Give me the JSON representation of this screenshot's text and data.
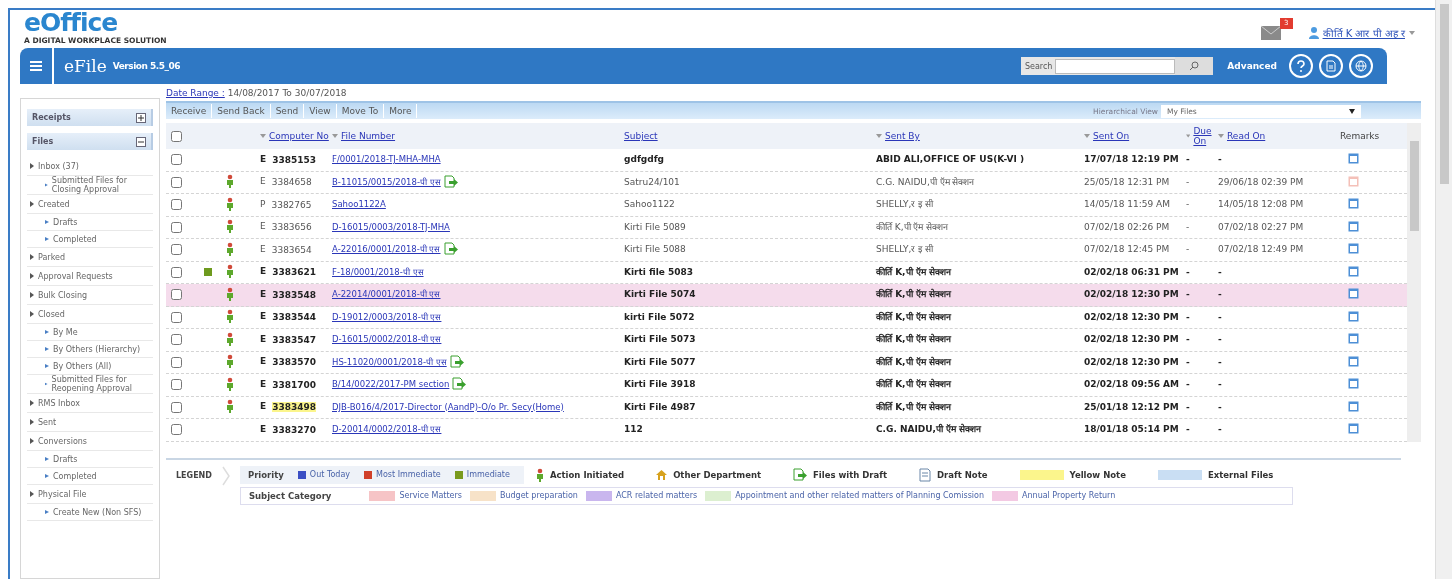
{
  "header": {
    "logo": "eOffice",
    "tagline": "A DIGITAL WORKPLACE SOLUTION",
    "notification_count": "3",
    "user": "कीर्ति K  आर पी अह र"
  },
  "app_bar": {
    "app": "eFile",
    "version": "Version 5.5_06",
    "search_label": "Search",
    "advanced": "Advanced"
  },
  "sidebar": {
    "sections": [
      {
        "label": "Receipts",
        "expanded": false
      },
      {
        "label": "Files",
        "expanded": true,
        "items": [
          {
            "label": "Inbox (37)",
            "children": [
              {
                "label": "Submitted Files for Closing Approval"
              }
            ]
          },
          {
            "label": "Created",
            "children": [
              {
                "label": "Drafts"
              },
              {
                "label": "Completed"
              }
            ]
          },
          {
            "label": "Parked"
          },
          {
            "label": "Approval Requests"
          },
          {
            "label": "Bulk Closing"
          },
          {
            "label": "Closed",
            "children": [
              {
                "label": "By Me"
              },
              {
                "label": "By Others (Hierarchy)"
              },
              {
                "label": "By Others (All)"
              },
              {
                "label": "Submitted Files for Reopening Approval"
              }
            ]
          },
          {
            "label": "RMS Inbox"
          },
          {
            "label": "Sent"
          },
          {
            "label": "Conversions",
            "children": [
              {
                "label": "Drafts"
              },
              {
                "label": "Completed"
              }
            ]
          },
          {
            "label": "Physical File",
            "children": [
              {
                "label": "Create New (Non SFS)"
              }
            ]
          }
        ]
      }
    ]
  },
  "date_range": {
    "label": "Date Range :",
    "value": " 14/08/2017 To 30/07/2018"
  },
  "toolbar": {
    "actions": [
      "Receive",
      "Send Back",
      "Send",
      "View",
      "Move To",
      "More"
    ],
    "view_label": "Hierarchical View",
    "view_value": "My Files"
  },
  "table": {
    "all_selected": false,
    "columns": [
      {
        "label": "Computer No",
        "menu": true
      },
      {
        "label": "File Number",
        "menu": true
      },
      {
        "label": "Subject",
        "menu": false
      },
      {
        "label": "Sent By",
        "menu": true
      },
      {
        "label": "Sent On",
        "menu": true
      },
      {
        "label": "Due On",
        "menu": true
      },
      {
        "label": "Read On",
        "menu": true
      },
      {
        "label": "Remarks",
        "menu": false
      }
    ],
    "rows": [
      {
        "type": "E",
        "number": "3385153",
        "priority_immediate": false,
        "file_number": "F/0001/2018-TJ-MHA-MHA",
        "subject": "gdfgdfg",
        "sent_by": "ABID ALI,OFFICE OF US(K-VI )",
        "sent_on": "17/07/18 12:19 PM",
        "due_on": "-",
        "read_on": "-",
        "unread": true,
        "action_initiated": false,
        "with_draft": false,
        "highlighted": false,
        "yellow_note": false,
        "remark_alert": false
      },
      {
        "type": "E",
        "number": "3384658",
        "priority_immediate": false,
        "file_number": "B-11015/0015/2018-पी एस",
        "subject": "Satru24/101",
        "sent_by": "C.G. NAIDU,पी ऍम सेक्शन",
        "sent_on": "25/05/18 12:31 PM",
        "due_on": "-",
        "read_on": "29/06/18 02:39 PM",
        "unread": false,
        "action_initiated": true,
        "with_draft": true,
        "highlighted": false,
        "yellow_note": false,
        "remark_alert": true
      },
      {
        "type": "P",
        "number": "3382765",
        "priority_immediate": false,
        "file_number": "Sahoo1122A",
        "subject": "Sahoo1122",
        "sent_by": "SHELLY,र इ सी",
        "sent_on": "14/05/18 11:59 AM",
        "due_on": "-",
        "read_on": "14/05/18 12:08 PM",
        "unread": false,
        "action_initiated": true,
        "with_draft": false,
        "highlighted": false,
        "yellow_note": false,
        "remark_alert": false
      },
      {
        "type": "E",
        "number": "3383656",
        "priority_immediate": false,
        "file_number": "D-16015/0003/2018-TJ-MHA",
        "subject": "Kirti File 5089",
        "sent_by": "कीर्ति K,पी ऍम सेक्शन",
        "sent_on": "07/02/18 02:26 PM",
        "due_on": "-",
        "read_on": "07/02/18 02:27 PM",
        "unread": false,
        "action_initiated": true,
        "with_draft": false,
        "highlighted": false,
        "yellow_note": false,
        "remark_alert": false
      },
      {
        "type": "E",
        "number": "3383654",
        "priority_immediate": false,
        "file_number": "A-22016/0001/2018-पी एस",
        "subject": "Kirti File 5088",
        "sent_by": "SHELLY,र इ सी",
        "sent_on": "07/02/18 12:45 PM",
        "due_on": "-",
        "read_on": "07/02/18 12:49 PM",
        "unread": false,
        "action_initiated": true,
        "with_draft": true,
        "highlighted": false,
        "yellow_note": false,
        "remark_alert": false
      },
      {
        "type": "E",
        "number": "3383621",
        "file_number": "F-18/0001/2018-पी एस",
        "subject": "Kirti file 5083",
        "sent_by": "कीर्ति K,पी ऍम सेक्शन",
        "sent_on": "02/02/18 06:31 PM",
        "due_on": "-",
        "read_on": "-",
        "unread": true,
        "action_initiated": true,
        "with_draft": false,
        "highlighted": false,
        "yellow_note": false,
        "remark_alert": false,
        "priority_immediate": true
      },
      {
        "type": "E",
        "number": "3383548",
        "priority_immediate": false,
        "file_number": "A-22014/0001/2018-पी एस",
        "subject": "Kirti File 5074",
        "sent_by": "कीर्ति K,पी ऍम सेक्शन",
        "sent_on": "02/02/18 12:30 PM",
        "due_on": "-",
        "read_on": "-",
        "unread": true,
        "action_initiated": true,
        "with_draft": false,
        "highlighted": true,
        "yellow_note": false,
        "remark_alert": false
      },
      {
        "type": "E",
        "number": "3383544",
        "priority_immediate": false,
        "file_number": "D-19012/0003/2018-पी एस",
        "subject": "kirti File 5072",
        "sent_by": "कीर्ति K,पी ऍम सेक्शन",
        "sent_on": "02/02/18 12:30 PM",
        "due_on": "-",
        "read_on": "-",
        "unread": true,
        "action_initiated": true,
        "with_draft": false,
        "highlighted": false,
        "yellow_note": false,
        "remark_alert": false
      },
      {
        "type": "E",
        "number": "3383547",
        "priority_immediate": false,
        "file_number": "D-16015/0002/2018-पी एस",
        "subject": "Kirti File 5073",
        "sent_by": "कीर्ति K,पी ऍम सेक्शन",
        "sent_on": "02/02/18 12:30 PM",
        "due_on": "-",
        "read_on": "-",
        "unread": true,
        "action_initiated": true,
        "with_draft": false,
        "highlighted": false,
        "yellow_note": false,
        "remark_alert": false
      },
      {
        "type": "E",
        "number": "3383570",
        "priority_immediate": false,
        "file_number": "HS-11020/0001/2018-पी एस",
        "subject": "Kirti File 5077",
        "sent_by": "कीर्ति K,पी ऍम सेक्शन",
        "sent_on": "02/02/18 12:30 PM",
        "due_on": "-",
        "read_on": "-",
        "unread": true,
        "action_initiated": true,
        "with_draft": true,
        "highlighted": false,
        "yellow_note": false,
        "remark_alert": false
      },
      {
        "type": "E",
        "number": "3381700",
        "priority_immediate": false,
        "file_number": "B/14/0022/2017-PM section",
        "subject": "Kirti File 3918",
        "sent_by": "कीर्ति K,पी ऍम सेक्शन",
        "sent_on": "02/02/18 09:56 AM",
        "due_on": "-",
        "read_on": "-",
        "unread": true,
        "action_initiated": true,
        "with_draft": true,
        "highlighted": false,
        "yellow_note": false,
        "remark_alert": false
      },
      {
        "type": "E",
        "number": "3383498",
        "priority_immediate": false,
        "file_number": "DJB-B016/4/2017-Director (AandP)-O/o Pr. Secy(Home)",
        "subject": "Kirti File 4987",
        "sent_by": "कीर्ति K,पी ऍम सेक्शन",
        "sent_on": "25/01/18 12:12 PM",
        "due_on": "-",
        "read_on": "-",
        "unread": true,
        "action_initiated": true,
        "with_draft": false,
        "highlighted": false,
        "yellow_note": true,
        "remark_alert": false
      },
      {
        "type": "E",
        "number": "3383270",
        "priority_immediate": false,
        "file_number": "D-20014/0002/2018-पी एस",
        "subject": "112",
        "sent_by": "C.G. NAIDU,पी ऍम सेक्शन",
        "sent_on": "18/01/18 05:14 PM",
        "due_on": "-",
        "read_on": "-",
        "unread": true,
        "action_initiated": false,
        "with_draft": false,
        "highlighted": false,
        "yellow_note": false,
        "remark_alert": false
      }
    ]
  },
  "legend": {
    "title": "LEGEND",
    "priority_label": "Priority",
    "priorities": [
      {
        "label": "Out Today",
        "color": "#3b4fc4"
      },
      {
        "label": "Most Immediate",
        "color": "#d0402a"
      },
      {
        "label": "Immediate",
        "color": "#7a9a1e"
      }
    ],
    "markers": [
      {
        "kind": "action",
        "label": "Action Initiated"
      },
      {
        "kind": "department",
        "label": "Other Department"
      },
      {
        "kind": "draft",
        "label": "Files with Draft"
      },
      {
        "kind": "note",
        "label": "Draft Note"
      },
      {
        "kind": "swatch",
        "label": "Yellow Note",
        "color": "#fbf58c"
      },
      {
        "kind": "swatch",
        "label": "External Files",
        "color": "#c9def3"
      }
    ],
    "category_label": "Subject Category",
    "categories": [
      {
        "label": "Service Matters",
        "color": "#f6c4c6"
      },
      {
        "label": "Budget preparation",
        "color": "#f7e2c8"
      },
      {
        "label": "ACR related matters",
        "color": "#c9b6ee"
      },
      {
        "label": "Appointment and other related matters of Planning Comission",
        "color": "#dcefd0"
      },
      {
        "label": "Annual Property Return",
        "color": "#f3c9e3"
      }
    ]
  }
}
